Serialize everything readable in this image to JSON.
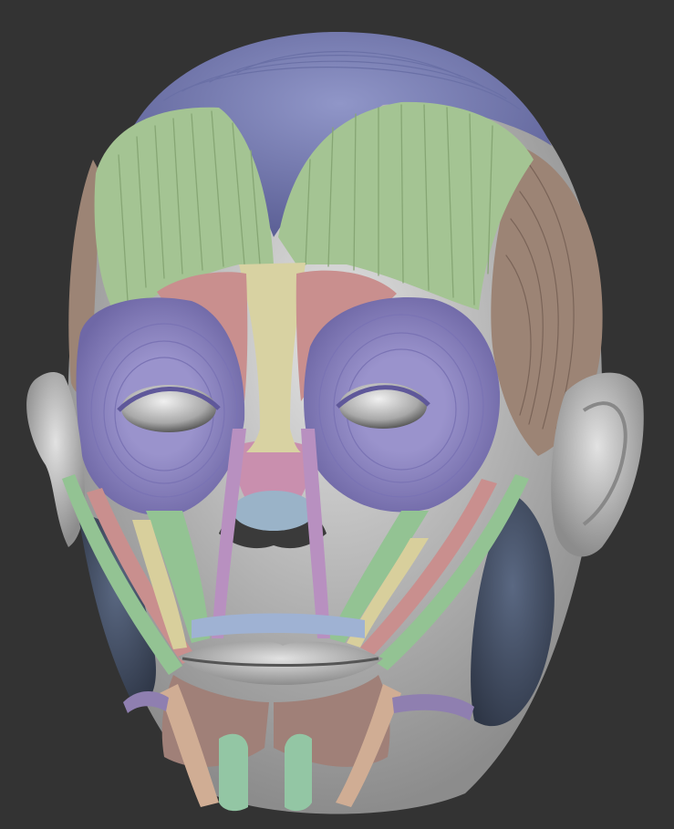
{
  "scene": {
    "subject": "",
    "background": "#333333"
  },
  "palette": {
    "galea": "#7c82b8",
    "frontalis": "#a4c493",
    "temporalis": "#9c8475",
    "procerus": "#d8d2a2",
    "corrugator": "#c98f8e",
    "orbicularis_oculi": "#8f88c4",
    "nasalis": "#c98fae",
    "zygomaticus": "#93c393",
    "levator_labii": "#d8cf9c",
    "orbicularis_oris": "#9fb2d3",
    "depressor": "#a08078",
    "mentalis": "#93c6a4",
    "masseter": "#48556c",
    "skin": "#c8c8c8"
  },
  "icons": [
    "head-model",
    "eye-left",
    "eye-right",
    "ear-left",
    "ear-right"
  ]
}
